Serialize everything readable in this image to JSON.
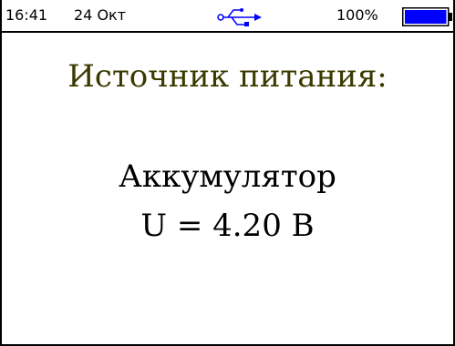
{
  "status_bar": {
    "time": "16:41",
    "date": "24 Окт",
    "battery_percent": "100%",
    "battery_level": 1.0,
    "usb_icon": "usb-icon",
    "battery_icon": "battery-icon"
  },
  "main": {
    "title": "Источник питания:",
    "source": "Аккумулятор",
    "voltage": "U = 4.20 В"
  },
  "colors": {
    "title": "#3a3a00",
    "text": "#000000",
    "usb": "#0000ff",
    "battery_fill": "#0000ff",
    "background": "#ffffff"
  }
}
